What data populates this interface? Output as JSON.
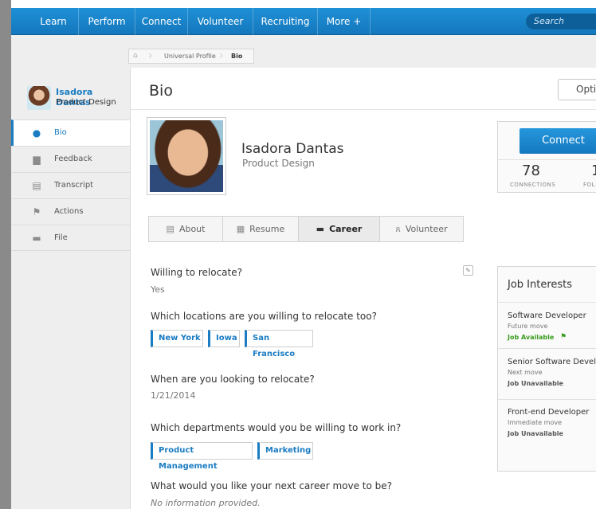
{
  "nav": {
    "items": [
      "Learn",
      "Perform",
      "Connect",
      "Volunteer",
      "Recruiting",
      "More +"
    ],
    "search_placeholder": "Search"
  },
  "breadcrumb": {
    "items": [
      "Universal Profile",
      "Bio"
    ]
  },
  "sidebar": {
    "user": {
      "name": "Isadora Dantas",
      "role": "Product Design"
    },
    "items": [
      {
        "label": "Bio",
        "icon": "person-icon",
        "active": true
      },
      {
        "label": "Feedback",
        "icon": "chat-icon"
      },
      {
        "label": "Transcript",
        "icon": "id-card-icon"
      },
      {
        "label": "Actions",
        "icon": "flag-icon"
      },
      {
        "label": "File",
        "icon": "folder-icon"
      }
    ]
  },
  "main": {
    "title": "Bio",
    "options_label": "Opti",
    "profile": {
      "name": "Isadora Dantas",
      "role": "Product Design"
    },
    "connect": {
      "button": "Connect",
      "connections_count": "78",
      "connections_label": "CONNECTIONS",
      "followers_count": "1",
      "followers_label": "FOL"
    },
    "tabs": [
      {
        "label": "About",
        "icon": "id-card-icon"
      },
      {
        "label": "Resume",
        "icon": "document-icon"
      },
      {
        "label": "Career",
        "icon": "briefcase-icon",
        "active": true
      },
      {
        "label": "Volunteer",
        "icon": "ribbon-icon"
      }
    ],
    "questions": [
      {
        "q": "Willing to relocate?",
        "a": "Yes"
      },
      {
        "q": "Which locations are you willing to relocate too?",
        "tags": [
          "New York",
          "Iowa",
          "San Francisco"
        ]
      },
      {
        "q": "When are you looking to relocate?",
        "a": "1/21/2014"
      },
      {
        "q": "Which departments would you be willing to work in?",
        "tags": [
          "Product Management",
          "Marketing"
        ]
      },
      {
        "q": "What would you like your next career move to be?",
        "a": "No information provided."
      }
    ],
    "job_interests": {
      "title": "Job Interests",
      "jobs": [
        {
          "title": "Software Developer",
          "move": "Future move",
          "status": "Job Available"
        },
        {
          "title": "Senior Software Devel",
          "move": "Next move",
          "status": "Job Unavailable"
        },
        {
          "title": "Front-end Developer",
          "move": "Immediate move",
          "status": "Job Unavailable"
        }
      ]
    }
  },
  "colors": {
    "brand_blue": "#1a7cc2",
    "available_green": "#3a9b1e",
    "nav_blue": "#1784cb"
  }
}
